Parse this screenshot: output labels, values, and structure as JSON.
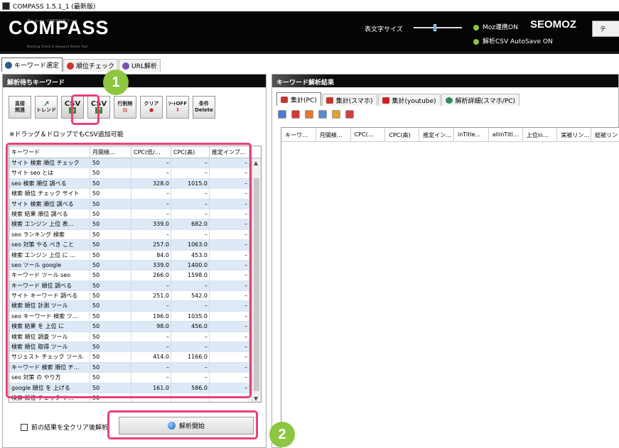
{
  "window": {
    "title": "COMPASS 1.5.1_1 (最新版)"
  },
  "header": {
    "logo": "COMPASS",
    "logo_sub": "ホームページSEO分析ツール",
    "logo_sub2": "Ranking Check & Keyword Select Tool",
    "font_size_label": "表文字サイズ",
    "moz_status": "Moz連携ON",
    "seomoz": "SEOMOZ",
    "csv_autosave": "解析CSV AutoSave ON",
    "corner_button": "テ",
    "accent": "#8dc63f"
  },
  "tabs": [
    {
      "label": "キーワード選定",
      "icon": "compass-icon"
    },
    {
      "label": "順位チェック",
      "icon": "rank-icon"
    },
    {
      "label": "URL解析",
      "icon": "url-icon"
    }
  ],
  "left": {
    "title": "解析待ちキーワード",
    "tools": [
      {
        "l1": "直接",
        "l2": "関連",
        "icon": "direct-related-icon"
      },
      {
        "l1": "",
        "l2": "トレンド",
        "icon": "trend-icon"
      },
      {
        "l1": "CSV",
        "l2": "",
        "icon": "csv-import-icon"
      },
      {
        "l1": "CSV",
        "l2": "",
        "icon": "csv-export-icon"
      },
      {
        "l1": "行削除",
        "l2": "",
        "icon": "row-delete-icon"
      },
      {
        "l1": "クリア",
        "l2": "",
        "icon": "clear-icon"
      },
      {
        "l1": "ｿｰﾄOFF",
        "l2": "",
        "icon": "sort-off-icon"
      },
      {
        "l1": "条件",
        "l2": "Delete",
        "icon": "condition-delete-icon"
      }
    ],
    "note": "※ドラッグ＆ドロップでもCSV追加可能",
    "columns": [
      "キーワード",
      "月間検…",
      "CPC(低/…",
      "CPC(高)",
      "推定インプ…"
    ],
    "rows": [
      [
        "サイト 検索 順位 チェック",
        "50",
        "–",
        "–",
        "–"
      ],
      [
        "サイト seo とは",
        "50",
        "–",
        "–",
        "–"
      ],
      [
        "seo 検索 順位 調べる",
        "50",
        "328.0",
        "1015.0",
        "–"
      ],
      [
        "検索 順位 チェック サイト",
        "50",
        "–",
        "–",
        "–"
      ],
      [
        "サイト 検索 順位 調べる",
        "50",
        "–",
        "–",
        "–"
      ],
      [
        "検索 結果 順位 調べる",
        "50",
        "–",
        "–",
        "–"
      ],
      [
        "検索 エンジン 上位 表…",
        "50",
        "339.0",
        "682.0",
        "–"
      ],
      [
        "seo ランキング 検索",
        "50",
        "–",
        "–",
        "–"
      ],
      [
        "seo 対策 やる べき こと",
        "50",
        "257.0",
        "1063.0",
        "–"
      ],
      [
        "検索 エンジン 上位 に …",
        "50",
        "84.0",
        "453.0",
        "–"
      ],
      [
        "seo ツール google",
        "50",
        "339.0",
        "1400.0",
        "–"
      ],
      [
        "キーワード ツール seo",
        "50",
        "266.0",
        "1598.0",
        "–"
      ],
      [
        "キーワード 順位 調べる",
        "50",
        "–",
        "–",
        "–"
      ],
      [
        "サイト キーワード 調べる",
        "50",
        "251.0",
        "542.0",
        "–"
      ],
      [
        "検索 順位 計測 ツール",
        "50",
        "–",
        "–",
        "–"
      ],
      [
        "seo キーワード 検索 ツ…",
        "50",
        "196.0",
        "1035.0",
        "–"
      ],
      [
        "検索 結果 を 上位 に",
        "50",
        "98.0",
        "456.0",
        "–"
      ],
      [
        "検索 順位 調査 ツール",
        "50",
        "–",
        "–",
        "–"
      ],
      [
        "検索 順位 取得 ツール",
        "50",
        "–",
        "–",
        "–"
      ],
      [
        "サジェスト チェック ツール",
        "50",
        "414.0",
        "1166.0",
        "–"
      ],
      [
        "キーワード 検索 順位 チ…",
        "50",
        "–",
        "–",
        "–"
      ],
      [
        "seo 対策 の やり方",
        "50",
        "–",
        "–",
        "–"
      ],
      [
        "google 順位 を 上げる",
        "50",
        "161.0",
        "586.0",
        "–"
      ],
      [
        "検索 順位 チェック ツ…",
        "50",
        "–",
        "–",
        "–"
      ]
    ],
    "clear_checkbox": "前の結果を全クリア後解析",
    "start_button": "解析開始"
  },
  "right": {
    "title": "キーワード解析結果",
    "tabs": [
      {
        "label": "集計(PC)",
        "color": "#c0392b"
      },
      {
        "label": "集計(スマホ)",
        "color": "#c0392b"
      },
      {
        "label": "集計(youtube)",
        "color": "#cc2222"
      },
      {
        "label": "解析詳細(スマホ/PC)",
        "color": "#2e8b57"
      }
    ],
    "columns": [
      "キーワ…",
      "月間検…",
      "CPC(…",
      "CPC(高)",
      "推定イン…",
      "inTitle…",
      "allinTitl…",
      "上位in…",
      "実被リン…",
      "総被リン"
    ]
  },
  "annotations": {
    "badge1": "1",
    "badge2": "2",
    "highlight": "#e8407a"
  }
}
